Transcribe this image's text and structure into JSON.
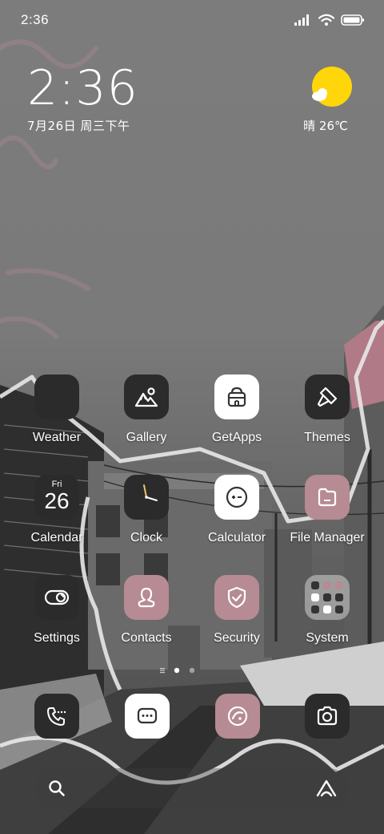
{
  "status_bar": {
    "time": "2:36",
    "icons": [
      "signal-icon",
      "wifi-icon",
      "battery-icon"
    ]
  },
  "clock_widget": {
    "time": "2:36",
    "date": "7月26日 周三下午"
  },
  "weather_widget": {
    "icon": "sun-cloud-icon",
    "text": "晴 26℃"
  },
  "apps": [
    {
      "label": "Weather",
      "icon": "weather-icon"
    },
    {
      "label": "Gallery",
      "icon": "mountain-photo-icon"
    },
    {
      "label": "GetApps",
      "icon": "shopping-bag-icon"
    },
    {
      "label": "Themes",
      "icon": "paintbrush-icon"
    },
    {
      "label": "Calendar",
      "icon": "calendar-icon",
      "day_name": "Fri",
      "day_number": "26"
    },
    {
      "label": "Clock",
      "icon": "clock-icon"
    },
    {
      "label": "Calculator",
      "icon": "calculator-icon"
    },
    {
      "label": "File Manager",
      "icon": "folder-icon"
    },
    {
      "label": "Settings",
      "icon": "toggle-icon"
    },
    {
      "label": "Contacts",
      "icon": "person-icon"
    },
    {
      "label": "Security",
      "icon": "shield-check-icon"
    },
    {
      "label": "System",
      "icon": "folder-grid-icon"
    }
  ],
  "page_indicator": {
    "pages": 2,
    "current": 1
  },
  "dock": [
    {
      "name": "phone",
      "icon": "phone-icon"
    },
    {
      "name": "messages",
      "icon": "message-icon"
    },
    {
      "name": "browser",
      "icon": "browser-icon"
    },
    {
      "name": "camera",
      "icon": "camera-icon"
    }
  ],
  "search_bar": {
    "left_icon": "search-icon",
    "right_icon": "assistant-icon"
  },
  "colors": {
    "icon_dark": "#2b2b2b",
    "icon_white": "#ffffff",
    "icon_pink": "#b68b93",
    "weather_sun": "#ffd60a"
  }
}
